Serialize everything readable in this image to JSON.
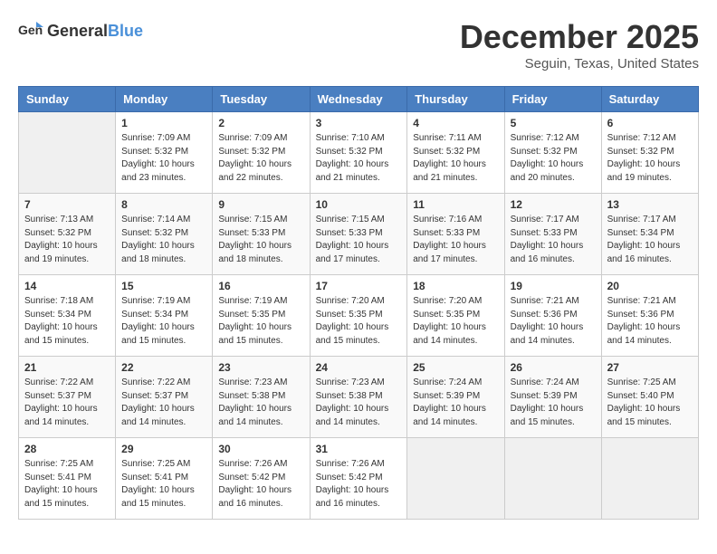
{
  "header": {
    "logo_general": "General",
    "logo_blue": "Blue",
    "month_title": "December 2025",
    "location": "Seguin, Texas, United States"
  },
  "days_of_week": [
    "Sunday",
    "Monday",
    "Tuesday",
    "Wednesday",
    "Thursday",
    "Friday",
    "Saturday"
  ],
  "weeks": [
    [
      {
        "day": "",
        "info": ""
      },
      {
        "day": "1",
        "info": "Sunrise: 7:09 AM\nSunset: 5:32 PM\nDaylight: 10 hours\nand 23 minutes."
      },
      {
        "day": "2",
        "info": "Sunrise: 7:09 AM\nSunset: 5:32 PM\nDaylight: 10 hours\nand 22 minutes."
      },
      {
        "day": "3",
        "info": "Sunrise: 7:10 AM\nSunset: 5:32 PM\nDaylight: 10 hours\nand 21 minutes."
      },
      {
        "day": "4",
        "info": "Sunrise: 7:11 AM\nSunset: 5:32 PM\nDaylight: 10 hours\nand 21 minutes."
      },
      {
        "day": "5",
        "info": "Sunrise: 7:12 AM\nSunset: 5:32 PM\nDaylight: 10 hours\nand 20 minutes."
      },
      {
        "day": "6",
        "info": "Sunrise: 7:12 AM\nSunset: 5:32 PM\nDaylight: 10 hours\nand 19 minutes."
      }
    ],
    [
      {
        "day": "7",
        "info": "Sunrise: 7:13 AM\nSunset: 5:32 PM\nDaylight: 10 hours\nand 19 minutes."
      },
      {
        "day": "8",
        "info": "Sunrise: 7:14 AM\nSunset: 5:32 PM\nDaylight: 10 hours\nand 18 minutes."
      },
      {
        "day": "9",
        "info": "Sunrise: 7:15 AM\nSunset: 5:33 PM\nDaylight: 10 hours\nand 18 minutes."
      },
      {
        "day": "10",
        "info": "Sunrise: 7:15 AM\nSunset: 5:33 PM\nDaylight: 10 hours\nand 17 minutes."
      },
      {
        "day": "11",
        "info": "Sunrise: 7:16 AM\nSunset: 5:33 PM\nDaylight: 10 hours\nand 17 minutes."
      },
      {
        "day": "12",
        "info": "Sunrise: 7:17 AM\nSunset: 5:33 PM\nDaylight: 10 hours\nand 16 minutes."
      },
      {
        "day": "13",
        "info": "Sunrise: 7:17 AM\nSunset: 5:34 PM\nDaylight: 10 hours\nand 16 minutes."
      }
    ],
    [
      {
        "day": "14",
        "info": "Sunrise: 7:18 AM\nSunset: 5:34 PM\nDaylight: 10 hours\nand 15 minutes."
      },
      {
        "day": "15",
        "info": "Sunrise: 7:19 AM\nSunset: 5:34 PM\nDaylight: 10 hours\nand 15 minutes."
      },
      {
        "day": "16",
        "info": "Sunrise: 7:19 AM\nSunset: 5:35 PM\nDaylight: 10 hours\nand 15 minutes."
      },
      {
        "day": "17",
        "info": "Sunrise: 7:20 AM\nSunset: 5:35 PM\nDaylight: 10 hours\nand 15 minutes."
      },
      {
        "day": "18",
        "info": "Sunrise: 7:20 AM\nSunset: 5:35 PM\nDaylight: 10 hours\nand 14 minutes."
      },
      {
        "day": "19",
        "info": "Sunrise: 7:21 AM\nSunset: 5:36 PM\nDaylight: 10 hours\nand 14 minutes."
      },
      {
        "day": "20",
        "info": "Sunrise: 7:21 AM\nSunset: 5:36 PM\nDaylight: 10 hours\nand 14 minutes."
      }
    ],
    [
      {
        "day": "21",
        "info": "Sunrise: 7:22 AM\nSunset: 5:37 PM\nDaylight: 10 hours\nand 14 minutes."
      },
      {
        "day": "22",
        "info": "Sunrise: 7:22 AM\nSunset: 5:37 PM\nDaylight: 10 hours\nand 14 minutes."
      },
      {
        "day": "23",
        "info": "Sunrise: 7:23 AM\nSunset: 5:38 PM\nDaylight: 10 hours\nand 14 minutes."
      },
      {
        "day": "24",
        "info": "Sunrise: 7:23 AM\nSunset: 5:38 PM\nDaylight: 10 hours\nand 14 minutes."
      },
      {
        "day": "25",
        "info": "Sunrise: 7:24 AM\nSunset: 5:39 PM\nDaylight: 10 hours\nand 14 minutes."
      },
      {
        "day": "26",
        "info": "Sunrise: 7:24 AM\nSunset: 5:39 PM\nDaylight: 10 hours\nand 15 minutes."
      },
      {
        "day": "27",
        "info": "Sunrise: 7:25 AM\nSunset: 5:40 PM\nDaylight: 10 hours\nand 15 minutes."
      }
    ],
    [
      {
        "day": "28",
        "info": "Sunrise: 7:25 AM\nSunset: 5:41 PM\nDaylight: 10 hours\nand 15 minutes."
      },
      {
        "day": "29",
        "info": "Sunrise: 7:25 AM\nSunset: 5:41 PM\nDaylight: 10 hours\nand 15 minutes."
      },
      {
        "day": "30",
        "info": "Sunrise: 7:26 AM\nSunset: 5:42 PM\nDaylight: 10 hours\nand 16 minutes."
      },
      {
        "day": "31",
        "info": "Sunrise: 7:26 AM\nSunset: 5:42 PM\nDaylight: 10 hours\nand 16 minutes."
      },
      {
        "day": "",
        "info": ""
      },
      {
        "day": "",
        "info": ""
      },
      {
        "day": "",
        "info": ""
      }
    ]
  ]
}
